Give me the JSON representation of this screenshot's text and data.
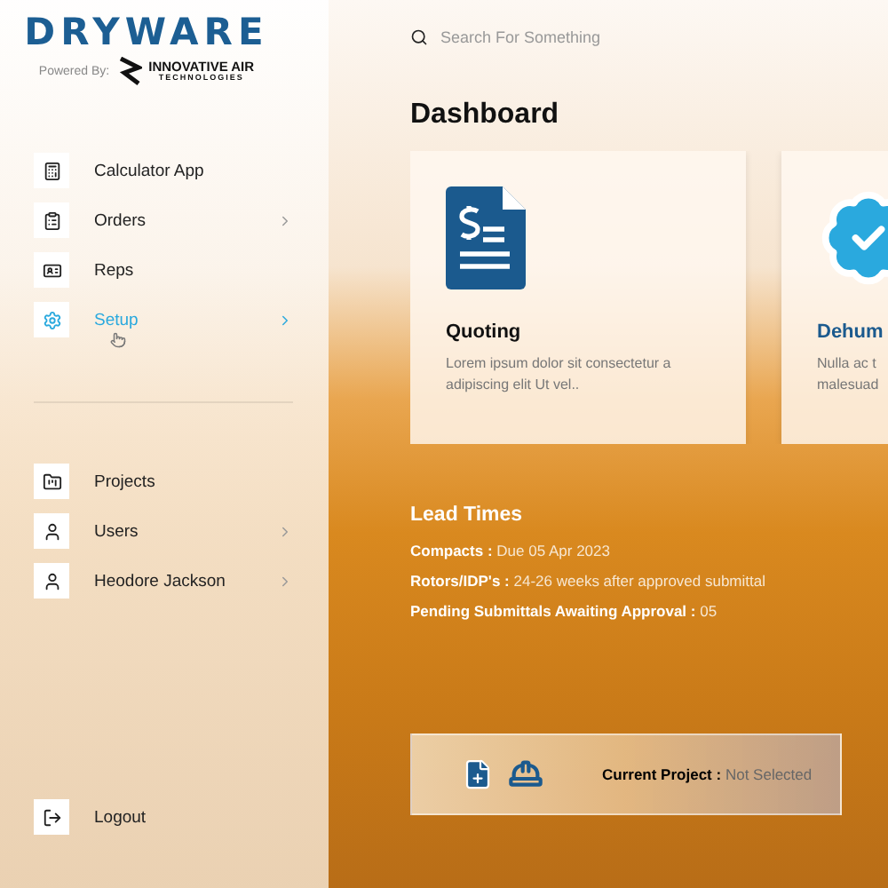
{
  "logo": {
    "brand": "DRYWARE",
    "powered_by": "Powered By:",
    "partner_line1": "INNOVATIVE AIR",
    "partner_line2": "TECHNOLOGIES"
  },
  "sidebar": {
    "groups": [
      {
        "items": [
          {
            "label": "Calculator App",
            "selected": false,
            "submenu": false
          },
          {
            "label": "Orders",
            "selected": false,
            "submenu": true
          },
          {
            "label": "Reps",
            "selected": false,
            "submenu": false
          },
          {
            "label": "Setup",
            "selected": true,
            "submenu": true
          }
        ]
      },
      {
        "items": [
          {
            "label": "Projects",
            "selected": false,
            "submenu": false
          },
          {
            "label": "Users",
            "selected": false,
            "submenu": true
          },
          {
            "label": "Heodore Jackson",
            "selected": false,
            "submenu": true
          }
        ]
      }
    ],
    "logout": "Logout"
  },
  "search": {
    "placeholder": "Search For Something"
  },
  "title": "Dashboard",
  "cards": [
    {
      "kind": "quote",
      "title": "Quoting",
      "lines": [
        "Lorem ipsum dolor sit consectetur a",
        "adipiscing elit Ut vel.."
      ]
    },
    {
      "kind": "badge",
      "title": "Dehum",
      "lines": [
        "Nulla ac t",
        "malesuad"
      ]
    }
  ],
  "lead_times": {
    "heading": "Lead Times",
    "rows": [
      {
        "label": "Compacts :",
        "value": "Due 05 Apr 2023"
      },
      {
        "label": "Rotors/IDP's :",
        "value": "24-26 weeks after approved submittal"
      },
      {
        "label": "Pending Submittals Awaiting Approval :",
        "value": "05"
      }
    ]
  },
  "current_project": {
    "label": "Current Project :",
    "value": "Not Selected"
  }
}
